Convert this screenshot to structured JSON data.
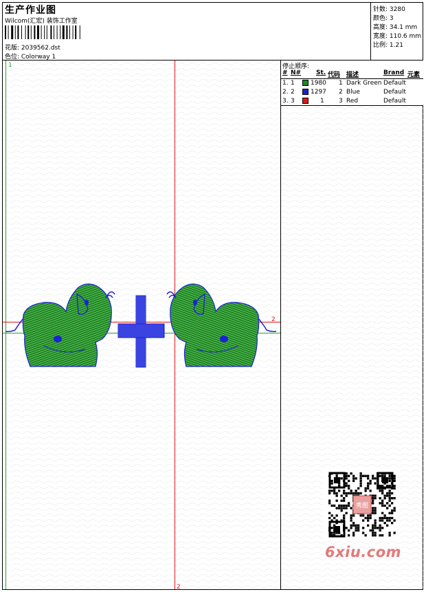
{
  "header": {
    "title": "生产作业图",
    "company": "Wilcom(汇宏) 装饰工作室",
    "design_file": "花版: 2039562.dst",
    "colorway": "色位:  Colorway 1"
  },
  "stats": {
    "stitches": "针数: 3280",
    "colors": "颜色: 3",
    "height": "高度: 34.1 mm",
    "width": "宽度: 110.6 mm",
    "scale": "比例: 1.21"
  },
  "markers": {
    "axis_1_top": "1",
    "axis_2_right": "2",
    "axis_2_bottom": "2"
  },
  "stop_sequence": {
    "title": "停止顺序:",
    "headers": [
      "#",
      "N#",
      "St.",
      "代码",
      "描述",
      "Brand",
      "元素"
    ],
    "rows": [
      {
        "idx": "1.",
        "num": "1",
        "color": "#1d8a22",
        "stitches": "1980",
        "code": "1",
        "desc": "Dark Green",
        "brand": "Default"
      },
      {
        "idx": "2.",
        "num": "2",
        "color": "#1b22d6",
        "stitches": "1297",
        "code": "2",
        "desc": "Blue",
        "brand": "Default"
      },
      {
        "idx": "3.",
        "num": "3",
        "color": "#e01818",
        "stitches": "1",
        "code": "3",
        "desc": "Red",
        "brand": "Default"
      }
    ]
  },
  "watermark": {
    "site": "6xiu.com",
    "seal": "秀图"
  },
  "colors": {
    "green": "#1d8a22",
    "blue": "#1b22d6",
    "red": "#e01818"
  }
}
